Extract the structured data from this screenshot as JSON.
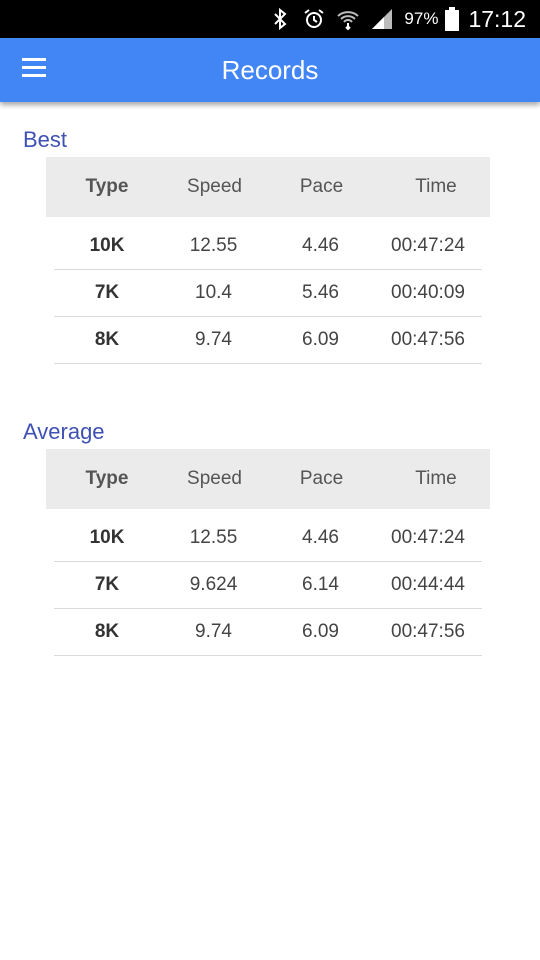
{
  "status": {
    "battery": "97%",
    "time": "17:12"
  },
  "appbar": {
    "title": "Records"
  },
  "best": {
    "title": "Best",
    "headers": [
      "Type",
      "Speed",
      "Pace",
      "Time"
    ],
    "rows": [
      [
        "10K",
        "12.55",
        "4.46",
        "00:47:24"
      ],
      [
        "7K",
        "10.4",
        "5.46",
        "00:40:09"
      ],
      [
        "8K",
        "9.74",
        "6.09",
        "00:47:56"
      ]
    ]
  },
  "average": {
    "title": "Average",
    "headers": [
      "Type",
      "Speed",
      "Pace",
      "Time"
    ],
    "rows": [
      [
        "10K",
        "12.55",
        "4.46",
        "00:47:24"
      ],
      [
        "7K",
        "9.624",
        "6.14",
        "00:44:44"
      ],
      [
        "8K",
        "9.74",
        "6.09",
        "00:47:56"
      ]
    ]
  }
}
